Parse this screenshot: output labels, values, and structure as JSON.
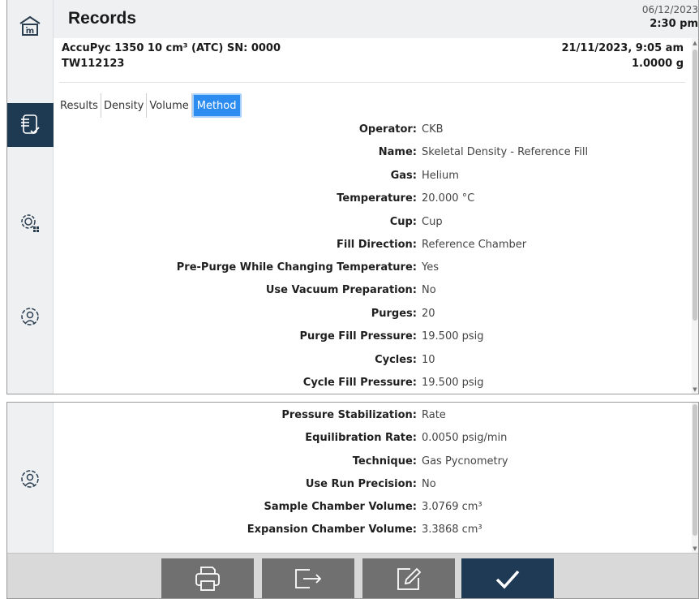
{
  "header": {
    "title": "Records",
    "date": "06/12/2023",
    "time": "2:30 pm"
  },
  "record": {
    "instrument": "AccuPyc 1350 10 cm³ (ATC) SN: 0000",
    "sample_id": "TW112123",
    "timestamp": "21/11/2023, 9:05 am",
    "mass": "1.0000 g"
  },
  "tabs": [
    {
      "label": "Results"
    },
    {
      "label": "Density"
    },
    {
      "label": "Volume"
    },
    {
      "label": "Method",
      "active": true
    }
  ],
  "method_fields": [
    {
      "label": "Operator:",
      "value": "CKB"
    },
    {
      "label": "Name:",
      "value": "Skeletal Density - Reference Fill"
    },
    {
      "label": "Gas:",
      "value": "Helium"
    },
    {
      "label": "Temperature:",
      "value": "20.000 °C"
    },
    {
      "label": "Cup:",
      "value": "Cup"
    },
    {
      "label": "Fill Direction:",
      "value": "Reference Chamber"
    },
    {
      "label": "Pre-Purge While Changing Temperature:",
      "value": "Yes"
    },
    {
      "label": "Use Vacuum Preparation:",
      "value": "No"
    },
    {
      "label": "Purges:",
      "value": "20"
    },
    {
      "label": "Purge Fill Pressure:",
      "value": "19.500 psig"
    },
    {
      "label": "Cycles:",
      "value": "10"
    },
    {
      "label": "Cycle Fill Pressure:",
      "value": "19.500 psig"
    }
  ],
  "method_fields_continued": [
    {
      "label": "Pressure Stabilization:",
      "value": "Rate"
    },
    {
      "label": "Equilibration Rate:",
      "value": "0.0050 psig/min"
    },
    {
      "label": "Technique:",
      "value": "Gas Pycnometry"
    },
    {
      "label": "Use Run Precision:",
      "value": "No"
    },
    {
      "label": "Sample Chamber Volume:",
      "value": "3.0769 cm³"
    },
    {
      "label": "Expansion Chamber Volume:",
      "value": "3.3868 cm³"
    }
  ],
  "sidebar": {
    "items": [
      {
        "icon": "home-icon"
      },
      {
        "icon": "records-icon",
        "active": true
      },
      {
        "icon": "system-settings-icon"
      },
      {
        "icon": "user-settings-icon"
      }
    ]
  },
  "toolbar": {
    "buttons": [
      {
        "icon": "print-icon"
      },
      {
        "icon": "export-icon"
      },
      {
        "icon": "edit-icon"
      },
      {
        "icon": "confirm-icon"
      }
    ]
  },
  "colors": {
    "accent": "#2d8cf0",
    "nav_active": "#1e3a52",
    "toolbar_button": "#707070",
    "toolbar_primary": "#1f3a55",
    "sidebar_bg": "#eef0f1"
  }
}
